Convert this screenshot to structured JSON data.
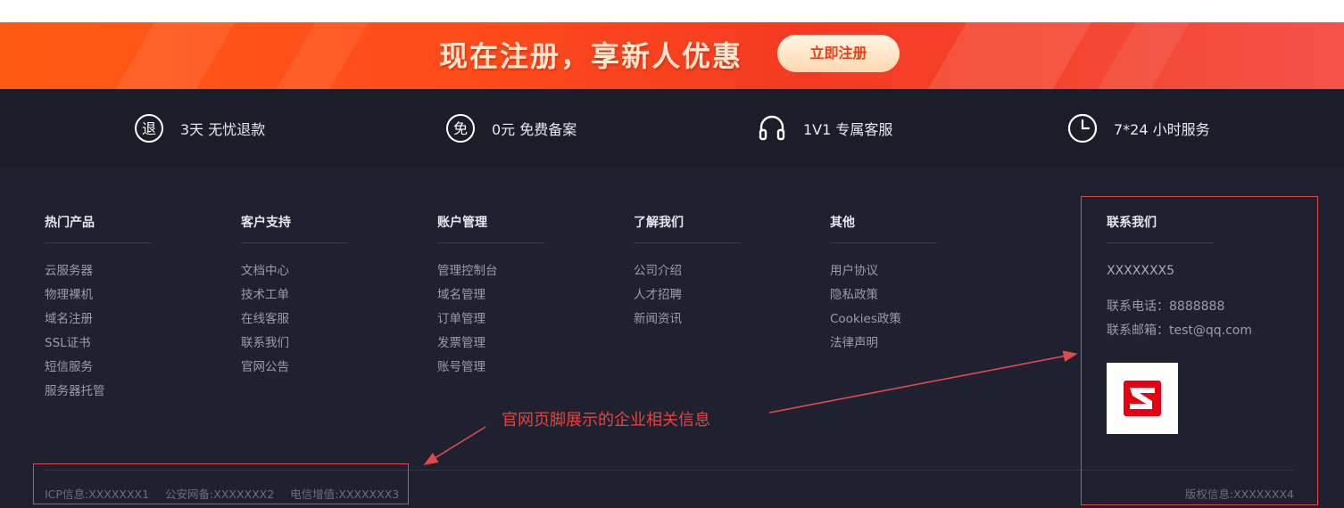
{
  "banner": {
    "headline": "现在注册，享新人优惠",
    "register_button": "立即注册"
  },
  "features": [
    {
      "icon": "refund-badge-icon",
      "glyph": "退",
      "text": "3天 无忧退款"
    },
    {
      "icon": "free-badge-icon",
      "glyph": "免",
      "text": "0元 免费备案"
    },
    {
      "icon": "headset-icon",
      "text": "1V1 专属客服"
    },
    {
      "icon": "clock-icon",
      "text": "7*24 小时服务"
    }
  ],
  "columns": [
    {
      "title": "热门产品",
      "links": [
        "云服务器",
        "物理裸机",
        "域名注册",
        "SSL证书",
        "短信服务",
        "服务器托管"
      ]
    },
    {
      "title": "客户支持",
      "links": [
        "文档中心",
        "技术工单",
        "在线客服",
        "联系我们",
        "官网公告"
      ]
    },
    {
      "title": "账户管理",
      "links": [
        "管理控制台",
        "域名管理",
        "订单管理",
        "发票管理",
        "账号管理"
      ]
    },
    {
      "title": "了解我们",
      "links": [
        "公司介绍",
        "人才招聘",
        "新闻资讯"
      ]
    },
    {
      "title": "其他",
      "links": [
        "用户协议",
        "隐私政策",
        "Cookies政策",
        "法律声明"
      ]
    }
  ],
  "contact": {
    "title": "联系我们",
    "company": "XXXXXXX5",
    "phone": "联系电话：8888888",
    "email": "联系邮箱：test@qq.com",
    "logo_color": "#e60012"
  },
  "bottom": {
    "icp": "ICP信息:XXXXXXX1",
    "police": "公安网备:XXXXXXX2",
    "telecom": "电信增值:XXXXXXX3",
    "copyright": "版权信息:XXXXXXX4"
  },
  "annotation": {
    "text": "官网页脚展示的企业相关信息",
    "color": "#e24a4a"
  }
}
